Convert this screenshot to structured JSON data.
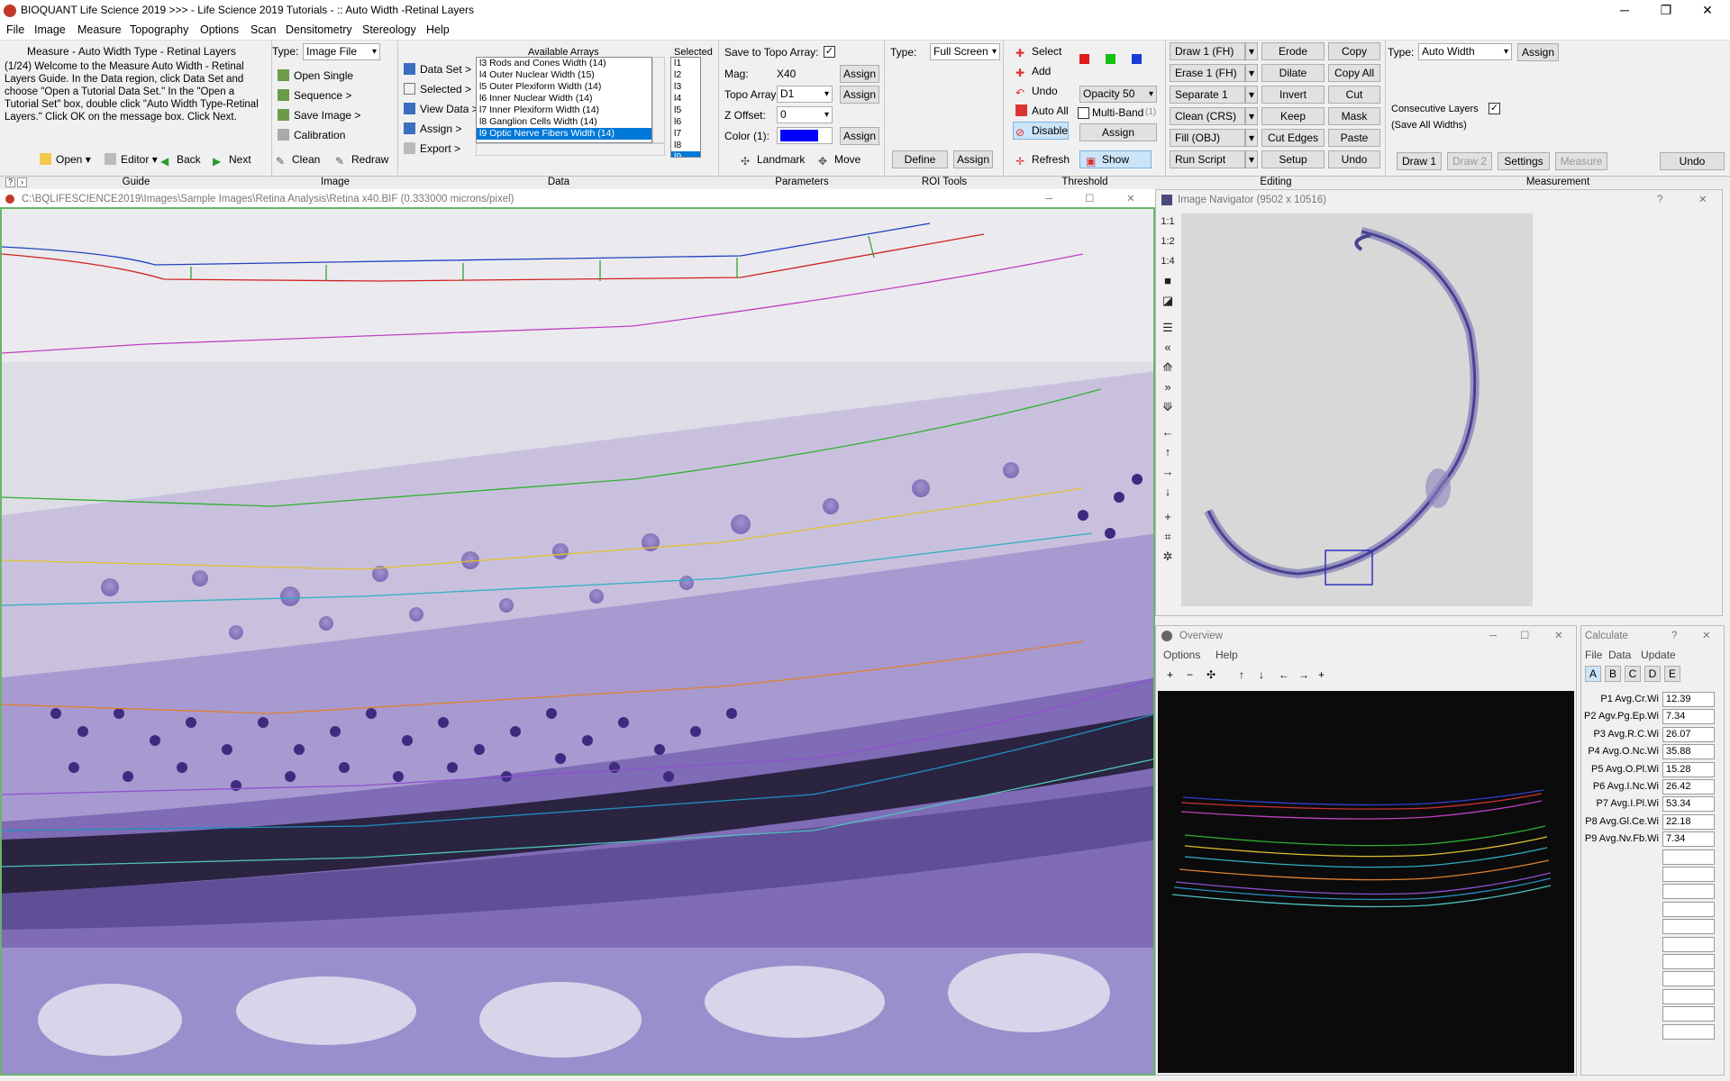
{
  "window": {
    "title": "BIOQUANT Life Science 2019 >>> - Life Science 2019 Tutorials - :: Auto Width -Retinal Layers",
    "minimize": "─",
    "maximize": "❐",
    "close": "✕"
  },
  "menu": [
    "File",
    "Image",
    "Measure",
    "Topography",
    "Options",
    "Scan",
    "Densitometry",
    "Stereology",
    "Help"
  ],
  "guide": {
    "title": "Measure - Auto Width Type - Retinal Layers",
    "text": "(1/24) Welcome to the Measure Auto Width - Retinal Layers Guide. In the Data region, click Data Set and choose \"Open a Tutorial Data Set.\" In the \"Open a Tutorial Set\" box, double click \"Auto Width Type-Retinal Layers.\" Click OK on the message box. Click Next.",
    "open": "Open",
    "editor": "Editor",
    "back": "Back",
    "next": "Next",
    "label": "Guide"
  },
  "image_panel": {
    "type_label": "Type:",
    "type_value": "Image File",
    "open_single": "Open Single",
    "sequence": "Sequence >",
    "save_image": "Save Image >",
    "calibration": "Calibration",
    "clean": "Clean",
    "redraw": "Redraw",
    "label": "Image"
  },
  "data_panel": {
    "data_set": "Data Set >",
    "selected": "Selected >",
    "view_data": "View Data >",
    "assign": "Assign >",
    "export": "Export >",
    "available_header": "Available Arrays",
    "selected_header": "Selected",
    "arrays": [
      "l3 Rods and Cones Width (14)",
      "l4 Outer Nuclear Width (15)",
      "l5 Outer Plexiform Width (14)",
      "l6 Inner Nuclear Width (14)",
      "l7 Inner Plexiform Width (14)",
      "l8 Ganglion Cells Width (14)",
      "l9 Optic Nerve Fibers Width (14)"
    ],
    "selected_items": [
      "l1",
      "l2",
      "l3",
      "l4",
      "l5",
      "l6",
      "l7",
      "l8",
      "l9"
    ],
    "label": "Data"
  },
  "params": {
    "save_topo": "Save to Topo Array:",
    "mag_label": "Mag:",
    "mag_value": "X40",
    "topo_label": "Topo Array:",
    "topo_value": "D1",
    "zoffset_label": "Z Offset:",
    "zoffset_value": "0",
    "color_label": "Color (1):",
    "assign": "Assign",
    "landmark": "Landmark",
    "move": "Move",
    "label": "Parameters"
  },
  "roi": {
    "type_label": "Type:",
    "type_value": "Full Screen",
    "define": "Define",
    "assign": "Assign",
    "label": "ROI Tools"
  },
  "threshold": {
    "select": "Select",
    "add": "Add",
    "undo": "Undo",
    "auto_all": "Auto All",
    "disable": "Disable",
    "refresh": "Refresh",
    "show": "Show",
    "opacity": "Opacity 50",
    "multiband": "Multi-Band",
    "multiband_count": "(1)",
    "assign": "Assign",
    "label": "Threshold",
    "colors": {
      "red": "#e31b1b",
      "green": "#13c213",
      "blue": "#1a3bdc"
    }
  },
  "editing": {
    "col1": [
      "Draw 1 (FH)",
      "Erase 1 (FH)",
      "Separate 1",
      "Clean (CRS)",
      "Fill (OBJ)",
      "Run Script"
    ],
    "col2": [
      "Erode",
      "Dilate",
      "Invert",
      "Keep",
      "Cut Edges",
      "Setup"
    ],
    "col3": [
      "Copy",
      "Copy All",
      "Cut",
      "Mask",
      "Paste",
      "Undo"
    ],
    "label": "Editing"
  },
  "measurement": {
    "type_label": "Type:",
    "type_value": "Auto Width",
    "assign": "Assign",
    "consecutive": "Consecutive Layers",
    "save_all": "(Save All Widths)",
    "draw1": "Draw 1",
    "draw2": "Draw 2",
    "settings": "Settings",
    "measure": "Measure",
    "undo": "Undo",
    "label": "Measurement"
  },
  "image_window": {
    "path": "C:\\BQLIFESCIENCE2019\\Images\\Sample Images\\Retina Analysis\\Retina x40.BIF (0.333000 microns/pixel)"
  },
  "navigator": {
    "title": "Image Navigator (9502 x 10516)",
    "help": "?",
    "close": "✕",
    "zoom": [
      "1:1",
      "1:2",
      "1:4"
    ],
    "tools": [
      "■",
      "◪",
      "☰",
      "«",
      "⟰",
      "»",
      "⟱",
      "←",
      "↑",
      "→",
      "↓",
      "+",
      "⌗",
      "✲"
    ]
  },
  "overview": {
    "title": "Overview",
    "menu": [
      "Options",
      "Help"
    ],
    "tools": [
      "+",
      "−",
      "✣",
      "↑",
      "↓",
      "←",
      "→",
      "+"
    ]
  },
  "calculate": {
    "title": "Calculate",
    "menu": [
      "File",
      "Data",
      "Update"
    ],
    "tabs": [
      "A",
      "B",
      "C",
      "D",
      "E"
    ],
    "rows": [
      {
        "key": "P1 Avg.Cr.Wi",
        "value": "12.39"
      },
      {
        "key": "P2 Agv.Pg.Ep.Wi",
        "value": "7.34"
      },
      {
        "key": "P3 Avg.R.C.Wi",
        "value": "26.07"
      },
      {
        "key": "P4 Avg.O.Nc.Wi",
        "value": "35.88"
      },
      {
        "key": "P5 Avg.O.Pl.Wi",
        "value": "15.28"
      },
      {
        "key": "P6 Avg.I.Nc.Wi",
        "value": "26.42"
      },
      {
        "key": "P7 Avg.I.Pl.Wi",
        "value": "53.34"
      },
      {
        "key": "P8 Avg.Gl.Ce.Wi",
        "value": "22.18"
      },
      {
        "key": "P9 Avg.Nv.Fb.Wi",
        "value": "7.34"
      }
    ]
  }
}
